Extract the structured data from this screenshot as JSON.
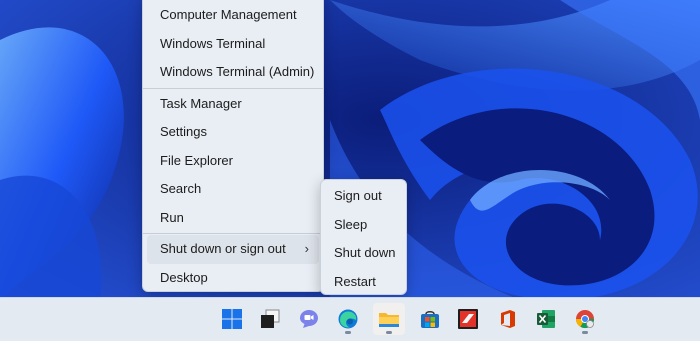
{
  "start_menu": {
    "items": [
      {
        "label": "Computer Management"
      },
      {
        "label": "Windows Terminal"
      },
      {
        "label": "Windows Terminal (Admin)"
      },
      {
        "label": "Task Manager"
      },
      {
        "label": "Settings"
      },
      {
        "label": "File Explorer"
      },
      {
        "label": "Search"
      },
      {
        "label": "Run"
      },
      {
        "label": "Shut down or sign out"
      },
      {
        "label": "Desktop"
      }
    ],
    "submenu_arrow": "›"
  },
  "shutdown_submenu": {
    "items": [
      {
        "label": "Sign out"
      },
      {
        "label": "Sleep"
      },
      {
        "label": "Shut down"
      },
      {
        "label": "Restart"
      }
    ]
  },
  "taskbar": {
    "icons": [
      {
        "name": "windows-start-icon"
      },
      {
        "name": "task-view-icon"
      },
      {
        "name": "teams-chat-icon"
      },
      {
        "name": "edge-icon"
      },
      {
        "name": "file-explorer-icon"
      },
      {
        "name": "microsoft-store-icon"
      },
      {
        "name": "red-app-icon"
      },
      {
        "name": "office-icon"
      },
      {
        "name": "excel-icon"
      },
      {
        "name": "chrome-profile-icon"
      }
    ]
  },
  "colors": {
    "wallpaper_dark": "#0a1a6e",
    "wallpaper_bright": "#2f6bff",
    "menu_bg": "#e9eef5",
    "taskbar_bg": "#e4eaf2"
  }
}
